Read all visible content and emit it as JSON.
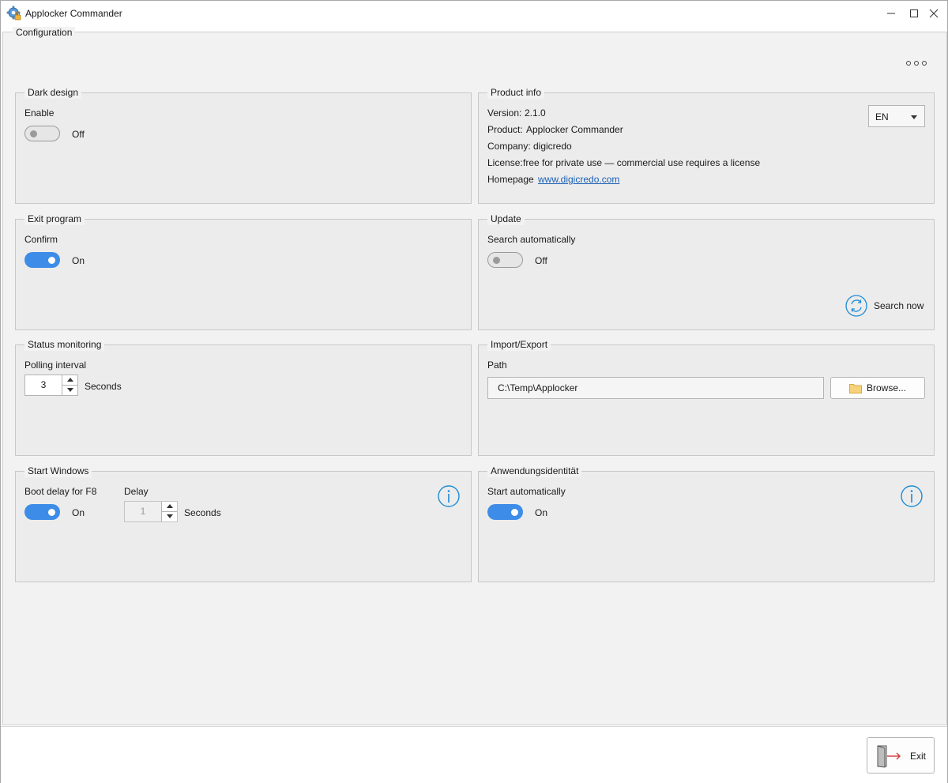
{
  "window": {
    "title": "Applocker Commander"
  },
  "config": {
    "title": "Configuration"
  },
  "dark_design": {
    "title": "Dark design",
    "label": "Enable",
    "state": "Off"
  },
  "product_info": {
    "title": "Product info",
    "version_label": "Version:",
    "version": "2.1.0",
    "product_label": "Product:",
    "product": "Applocker Commander",
    "company_label": "Company:",
    "company": "digicredo",
    "license_label": "License:",
    "license": "free for private use — commercial use requires a license",
    "homepage_label": "Homepage",
    "homepage": "www.digicredo.com",
    "language": "EN"
  },
  "exit_program": {
    "title": "Exit program",
    "label": "Confirm",
    "state": "On"
  },
  "update": {
    "title": "Update",
    "label": "Search automatically",
    "state": "Off",
    "search_now": "Search now"
  },
  "status_monitoring": {
    "title": "Status monitoring",
    "label": "Polling interval",
    "value": "3",
    "unit": "Seconds"
  },
  "import_export": {
    "title": "Import/Export",
    "label": "Path",
    "path": "C:\\Temp\\Applocker",
    "browse": "Browse..."
  },
  "start_windows": {
    "title": "Start Windows",
    "boot_label": "Boot delay for F8",
    "boot_state": "On",
    "delay_label": "Delay",
    "delay_value": "1",
    "delay_unit": "Seconds"
  },
  "app_identity": {
    "title": "Anwendungsidentität",
    "label": "Start automatically",
    "state": "On"
  },
  "footer": {
    "exit": "Exit"
  },
  "colors": {
    "accent": "#3d8de8",
    "info": "#1b8bd6",
    "link": "#1a5fb4",
    "exit_arrow": "#d23a3a"
  }
}
